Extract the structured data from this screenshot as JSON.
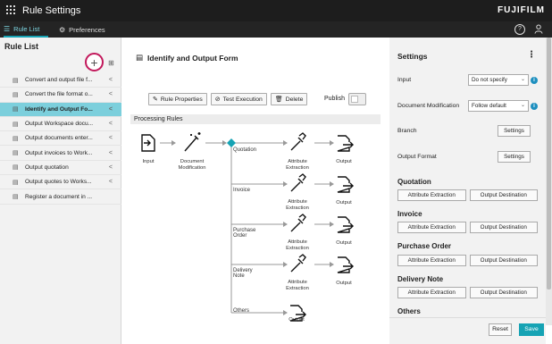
{
  "app": {
    "title": "Rule Settings",
    "brand": "FUJIFILM"
  },
  "tabs": [
    {
      "label": "Rule List",
      "icon": "list-icon",
      "active": true
    },
    {
      "label": "Preferences",
      "icon": "gear-icon",
      "active": false
    }
  ],
  "header_icons": [
    "help-icon",
    "user-icon"
  ],
  "left": {
    "title": "Rule List",
    "rules": [
      {
        "label": "Convert and output file f..."
      },
      {
        "label": "Convert the file format o..."
      },
      {
        "label": "Identify and Output Fo...",
        "active": true
      },
      {
        "label": "Output Workspace docu..."
      },
      {
        "label": "Output documents enter..."
      },
      {
        "label": "Output invoices to Work..."
      },
      {
        "label": "Output quotation"
      },
      {
        "label": "Output quotes to Works..."
      },
      {
        "label": "Register a document in ..."
      }
    ]
  },
  "center": {
    "form_title": "Identify and Output Form",
    "toolbar": {
      "rule_properties": "Rule Properties",
      "test_execution": "Test Execution",
      "delete": "Delete",
      "publish": "Publish"
    },
    "processing_rules": "Processing Rules",
    "flow": {
      "input": "Input",
      "doc_mod_1": "Document",
      "doc_mod_2": "Modification",
      "attr_1": "Attribute",
      "attr_2": "Extraction",
      "output": "Output",
      "branches": [
        "Quotation",
        "Invoice",
        "Purchase Order",
        "Delivery Note",
        "Others"
      ]
    }
  },
  "right": {
    "title": "Settings",
    "input_label": "Input",
    "input_value": "Do not specify",
    "docmod_label": "Document Modification",
    "docmod_value": "Follow default",
    "branch_label": "Branch",
    "output_format_label": "Output Format",
    "settings_btn": "Settings",
    "attr_btn": "Attribute Extraction",
    "dest_btn": "Output Destination",
    "sections": [
      "Quotation",
      "Invoice",
      "Purchase Order",
      "Delivery Note",
      "Others"
    ],
    "reset": "Reset",
    "save": "Save"
  },
  "colors": {
    "accent": "#16a3b4",
    "selected_row": "#7ccfdc",
    "highlight_ring": "#c2185b",
    "topbar": "#1d1d1d"
  }
}
